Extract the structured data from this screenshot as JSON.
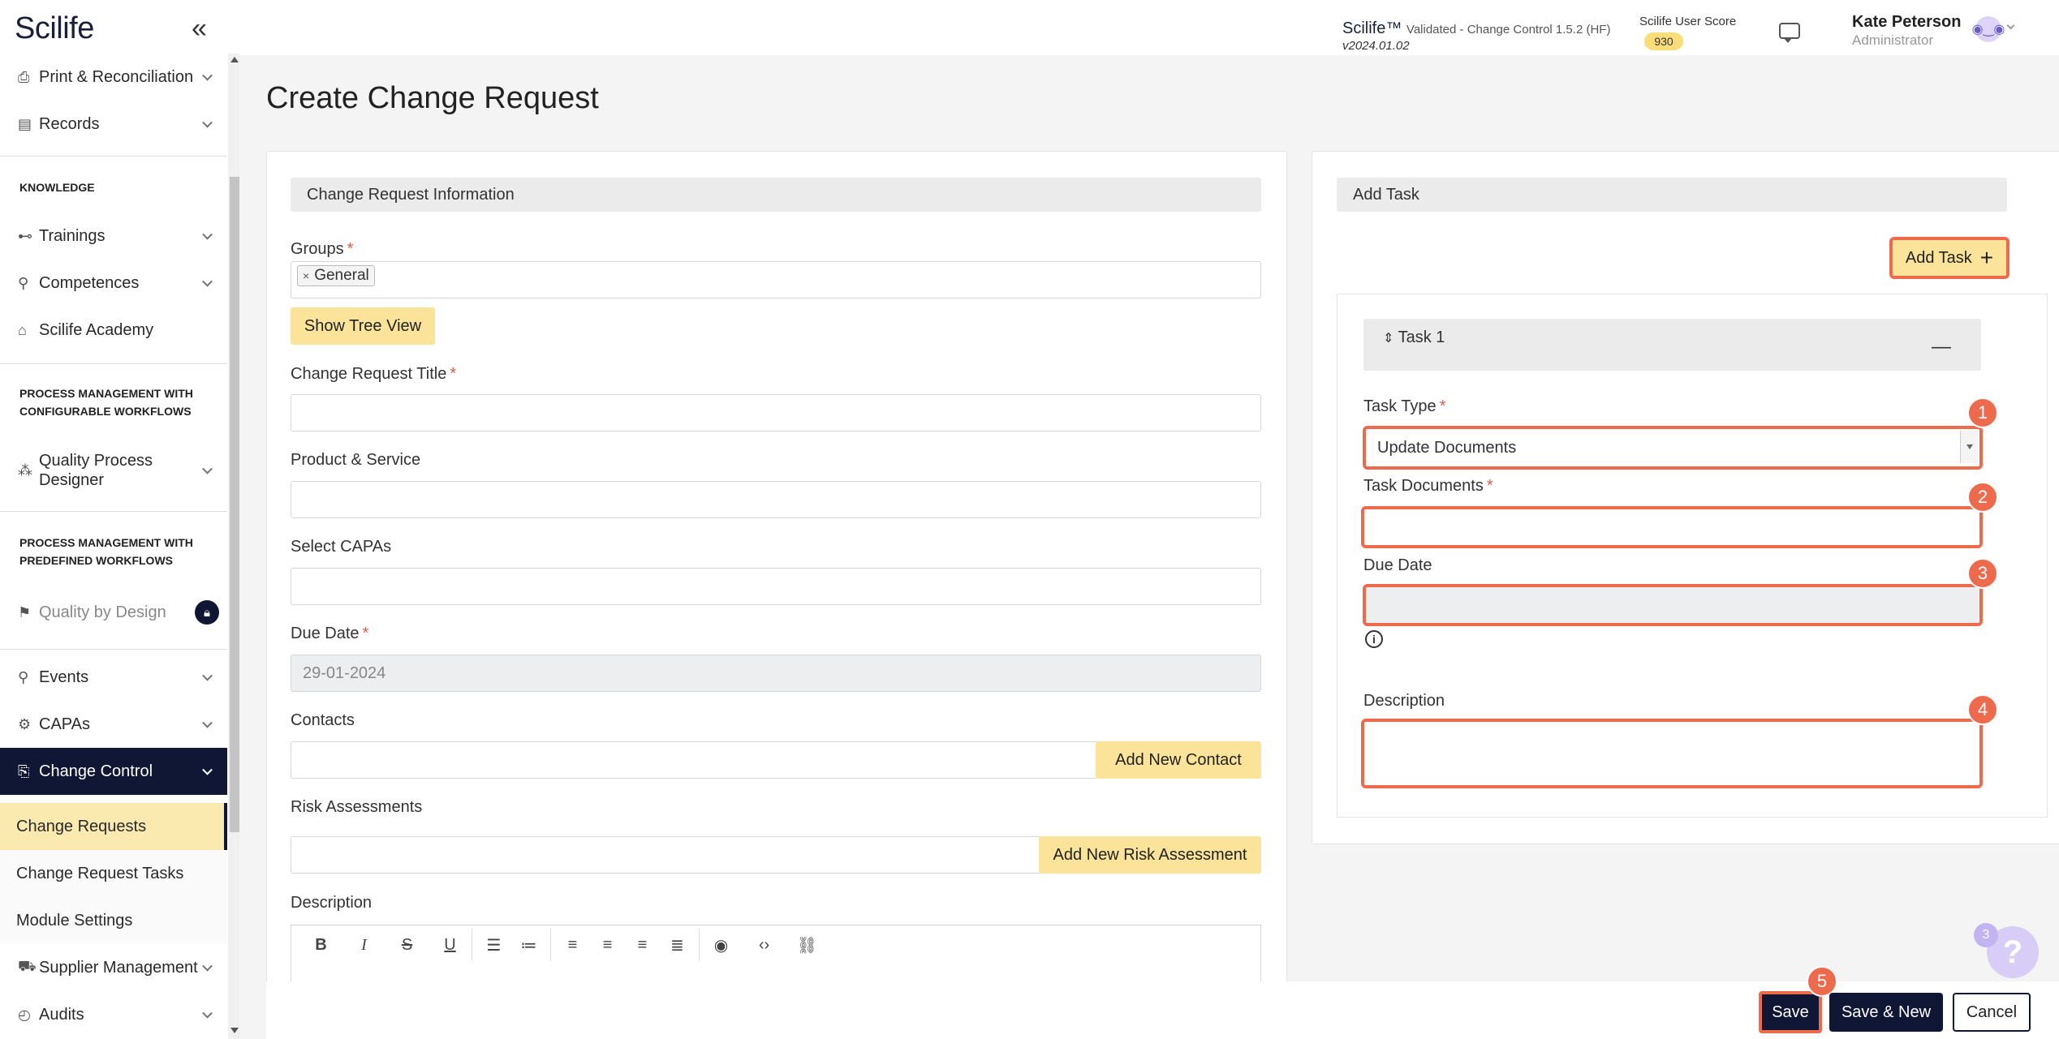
{
  "app": {
    "logo": "Scilife"
  },
  "sidebar": {
    "sections": {
      "knowledge": "KNOWLEDGE",
      "configurable": "PROCESS MANAGEMENT WITH CONFIGURABLE WORKFLOWS",
      "predefined": "PROCESS MANAGEMENT WITH PREDEFINED WORKFLOWS"
    },
    "items": {
      "print": "Print & Reconciliation",
      "records": "Records",
      "trainings": "Trainings",
      "competences": "Competences",
      "academy": "Scilife Academy",
      "qpd": "Quality Process Designer",
      "qbd": "Quality by Design",
      "events": "Events",
      "capas": "CAPAs",
      "change_control": "Change Control",
      "change_requests": "Change Requests",
      "change_request_tasks": "Change Request Tasks",
      "module_settings": "Module Settings",
      "supplier": "Supplier Management",
      "audits": "Audits"
    }
  },
  "topbar": {
    "product": "Scilife™",
    "status": "Validated - Change Control 1.5.2 (HF)",
    "version": "v2024.01.02",
    "score_label": "Scilife User Score",
    "score": "930",
    "user_name": "Kate Peterson",
    "user_role": "Administrator"
  },
  "page": {
    "title": "Create Change Request"
  },
  "form": {
    "header": "Change Request Information",
    "groups_label": "Groups",
    "groups_tag": "General",
    "tree_view_btn": "Show Tree View",
    "title_label": "Change Request Title",
    "product_label": "Product & Service",
    "capas_label": "Select CAPAs",
    "due_date_label": "Due Date",
    "due_date_value": "29-01-2024",
    "contacts_label": "Contacts",
    "add_contact_btn": "Add New Contact",
    "risk_label": "Risk Assessments",
    "add_risk_btn": "Add New Risk Assessment",
    "description_label": "Description"
  },
  "task_panel": {
    "header": "Add Task",
    "add_task_btn": "Add Task",
    "task_title": "Task 1",
    "task_type_label": "Task Type",
    "task_type_value": "Update Documents",
    "task_docs_label": "Task Documents",
    "due_date_label": "Due Date",
    "description_label": "Description"
  },
  "badges": [
    "1",
    "2",
    "3",
    "4",
    "5"
  ],
  "footer": {
    "save": "Save",
    "save_new": "Save & New",
    "cancel": "Cancel"
  },
  "help": {
    "count": "3",
    "icon": "?"
  },
  "colors": {
    "navy": "#0f1735",
    "yellow": "#fbe39a",
    "highlight": "#ee6a4d"
  }
}
